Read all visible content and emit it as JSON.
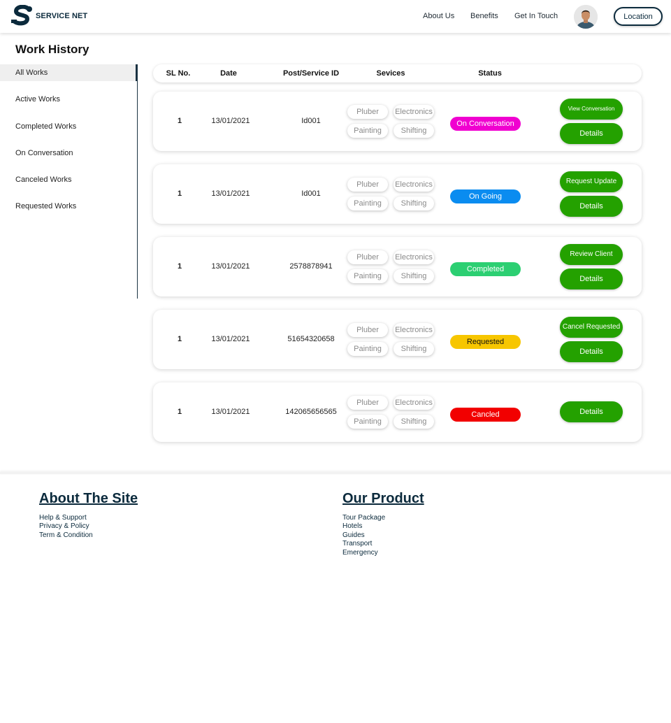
{
  "header": {
    "brand": "SERVICE NET",
    "nav": [
      "About Us",
      "Benefits",
      "Get In Touch"
    ],
    "location_button": "Location"
  },
  "page": {
    "title": "Work History"
  },
  "sidebar": {
    "items": [
      {
        "label": "All Works",
        "active": true
      },
      {
        "label": "Active Works"
      },
      {
        "label": "Completed Works"
      },
      {
        "label": "On Conversation"
      },
      {
        "label": "Canceled Works"
      },
      {
        "label": "Requested Works"
      }
    ]
  },
  "table": {
    "headers": [
      "SL No.",
      "Date",
      "Post/Service ID",
      "Sevices",
      "Status"
    ],
    "rows": [
      {
        "sl": "1",
        "date": "13/01/2021",
        "id": "Id001",
        "services": [
          "Pluber",
          "Electronics",
          "Painting",
          "Shifting"
        ],
        "status": "On Conversation",
        "status_color": "#f000d0",
        "action": "View Conversation",
        "details": "Details"
      },
      {
        "sl": "1",
        "date": "13/01/2021",
        "id": "Id001",
        "services": [
          "Pluber",
          "Electronics",
          "Painting",
          "Shifting"
        ],
        "status": "On Going",
        "status_color": "#0a8cf0",
        "action": "Request Update",
        "details": "Details"
      },
      {
        "sl": "1",
        "date": "13/01/2021",
        "id": "2578878941",
        "services": [
          "Pluber",
          "Electronics",
          "Painting",
          "Shifting"
        ],
        "status": "Completed",
        "status_color": "#2ccf72",
        "action": "Review Client",
        "details": "Details"
      },
      {
        "sl": "1",
        "date": "13/01/2021",
        "id": "51654320658",
        "services": [
          "Pluber",
          "Electronics",
          "Painting",
          "Shifting"
        ],
        "status": "Requested",
        "status_color": "#f7c600",
        "status_text_color": "#111",
        "action": "Cancel Requested",
        "details": "Details"
      },
      {
        "sl": "1",
        "date": "13/01/2021",
        "id": "142065656565",
        "services": [
          "Pluber",
          "Electronics",
          "Painting",
          "Shifting"
        ],
        "status": "Cancled",
        "status_color": "#f20000",
        "action": null,
        "details": "Details"
      }
    ]
  },
  "footer": {
    "about": {
      "title": "About The Site",
      "links": [
        "Help & Support",
        "Privacy & Policy",
        "Term & Condition"
      ]
    },
    "product": {
      "title": "Our Product",
      "links": [
        "Tour Package",
        "Hotels",
        "Guides",
        "Transport",
        "Emergency"
      ]
    }
  },
  "colors": {
    "brand_dark": "#0b2a3c",
    "button_green": "#24a100"
  }
}
